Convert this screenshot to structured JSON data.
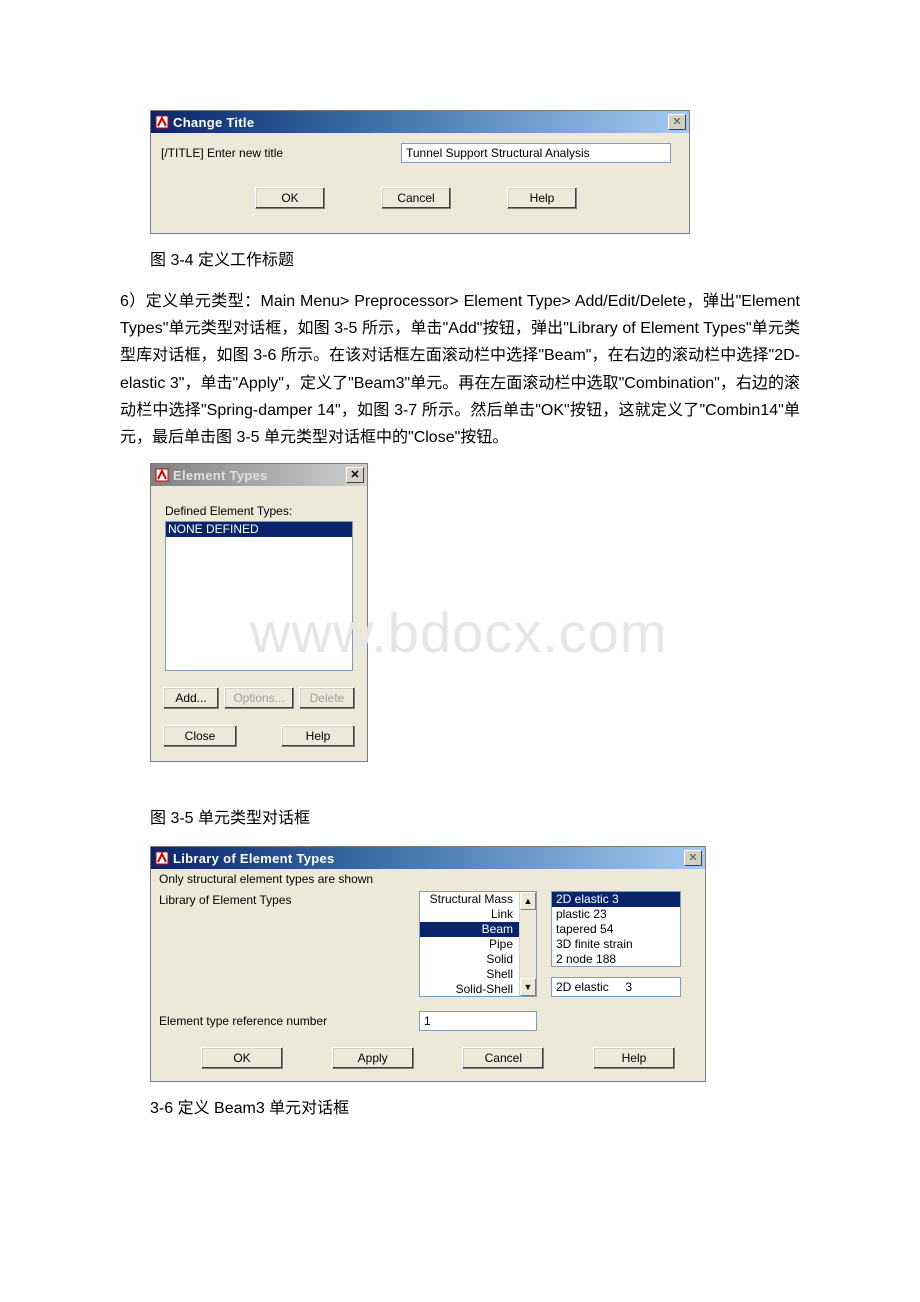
{
  "watermark": "www.bdocx.com",
  "dialog1": {
    "title": "Change Title",
    "label": "[/TITLE]  Enter new title",
    "value": "Tunnel Support Structural Analysis",
    "ok": "OK",
    "cancel": "Cancel",
    "help": "Help"
  },
  "caption1": "图 3-4 定义工作标题",
  "paragraph": "6）定义单元类型：Main Menu> Preprocessor> Element Type> Add/Edit/Delete，弹出\"Element Types\"单元类型对话框，如图 3-5 所示，单击\"Add\"按钮，弹出\"Library of Element Types\"单元类型库对话框，如图 3-6 所示。在该对话框左面滚动栏中选择\"Beam\"，在右边的滚动栏中选择\"2D-elastic 3\"，单击\"Apply\"，定义了\"Beam3\"单元。再在左面滚动栏中选取\"Combination\"，右边的滚动栏中选择\"Spring-damper 14\"，如图 3-7 所示。然后单击\"OK\"按钮，这就定义了\"Combin14\"单元，最后单击图 3-5 单元类型对话框中的\"Close\"按钮。",
  "dialog2": {
    "title": "Element Types",
    "label": "Defined Element Types:",
    "none": "NONE DEFINED",
    "add": "Add...",
    "options": "Options...",
    "delete": "Delete",
    "close": "Close",
    "help": "Help"
  },
  "caption2": "图 3-5 单元类型对话框",
  "dialog3": {
    "title": "Library of Element Types",
    "line1": "Only structural element types are shown",
    "lib_label": "Library of Element Types",
    "left_list": [
      "Structural Mass",
      "Link",
      "Beam",
      "Pipe",
      "Solid",
      "Shell",
      "Solid-Shell"
    ],
    "left_selected_index": 2,
    "right_list": [
      "2D elastic     3",
      "plastic   23",
      "tapered   54",
      "3D finite strain",
      "2 node   188"
    ],
    "right_selected_index": 0,
    "selected_show": "2D elastic     3",
    "ref_label": "Element type reference number",
    "ref_value": "1",
    "ok": "OK",
    "apply": "Apply",
    "cancel": "Cancel",
    "help": "Help"
  },
  "caption3": "3-6 定义 Beam3 单元对话框"
}
